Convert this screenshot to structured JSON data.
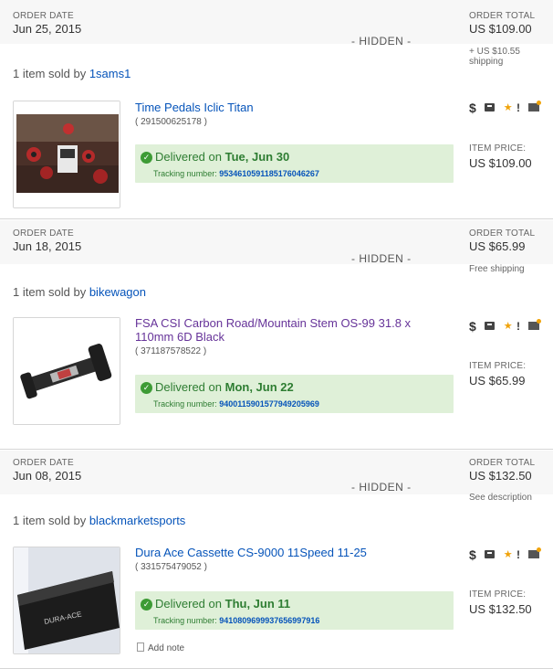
{
  "labels": {
    "order_date": "ORDER DATE",
    "order_total": "ORDER TOTAL",
    "hidden": "- HIDDEN -",
    "item_price": "ITEM PRICE:",
    "sold_by_prefix": "1 item sold by",
    "delivered_on": "Delivered on",
    "tracking_number": "Tracking number:",
    "add_note": "Add note"
  },
  "icons": [
    "dollar-icon",
    "package-icon",
    "star-feedback-icon",
    "alert-icon",
    "message-icon"
  ],
  "colors": {
    "link": "#0654ba",
    "visited": "#663399",
    "delivered_bg": "#dff0d8",
    "delivered_text": "#2e7d32"
  },
  "orders": [
    {
      "date": "Jun 25, 2015",
      "total": "US $109.00",
      "shipping": "+ US $10.55\nshipping",
      "seller": "1sams1",
      "item_title": "Time Pedals Iclic Titan",
      "item_id": "( 291500625178 )",
      "delivered_date": "Tue, Jun 30",
      "tracking": "9534610591185176046267",
      "item_price": "US $109.00"
    },
    {
      "date": "Jun 18, 2015",
      "total": "US $65.99",
      "shipping": "Free shipping",
      "seller": "bikewagon",
      "item_title": "FSA CSI Carbon Road/Mountain Stem OS-99 31.8 x 110mm 6D Black",
      "item_id": "( 371187578522 )",
      "delivered_date": "Mon, Jun 22",
      "tracking": "9400115901577949205969",
      "item_price": "US $65.99"
    },
    {
      "date": "Jun 08, 2015",
      "total": "US $132.50",
      "shipping": "See description",
      "seller": "blackmarketsports",
      "item_title": "Dura Ace Cassette CS-9000 11Speed 11-25",
      "item_id": "( 331575479052 )",
      "delivered_date": "Thu, Jun 11",
      "tracking": "9410809699937656997916",
      "item_price": "US $132.50"
    }
  ]
}
